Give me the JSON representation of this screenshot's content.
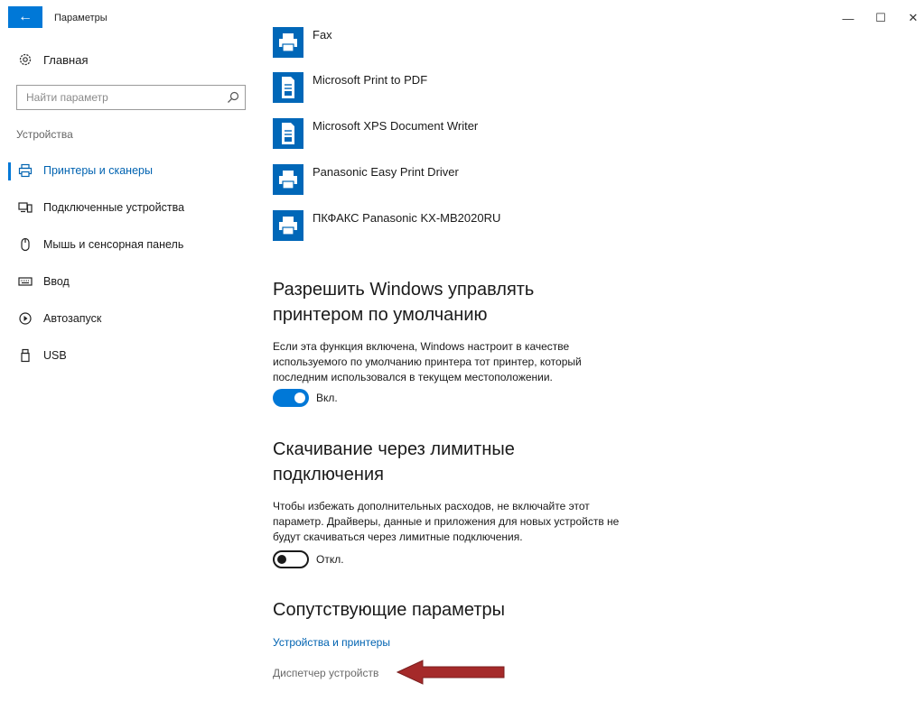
{
  "window": {
    "title": "Параметры",
    "back_glyph": "←",
    "minimize_glyph": "—",
    "maximize_glyph": "☐",
    "close_glyph": "✕"
  },
  "sidebar": {
    "home_label": "Главная",
    "search_placeholder": "Найти параметр",
    "section_label": "Устройства",
    "items": [
      {
        "label": "Принтеры и сканеры",
        "icon": "printer-icon",
        "active": true
      },
      {
        "label": "Подключенные устройства",
        "icon": "devices-icon",
        "active": false
      },
      {
        "label": "Мышь и сенсорная панель",
        "icon": "mouse-icon",
        "active": false
      },
      {
        "label": "Ввод",
        "icon": "keyboard-icon",
        "active": false
      },
      {
        "label": "Автозапуск",
        "icon": "autoplay-icon",
        "active": false
      },
      {
        "label": "USB",
        "icon": "usb-icon",
        "active": false
      }
    ]
  },
  "main": {
    "printers": [
      {
        "name": "Fax",
        "icon": "fax-printer-icon"
      },
      {
        "name": "Microsoft Print to PDF",
        "icon": "document-printer-icon"
      },
      {
        "name": "Microsoft XPS Document Writer",
        "icon": "document-printer-icon"
      },
      {
        "name": "Panasonic Easy Print Driver",
        "icon": "printer-icon"
      },
      {
        "name": "ПКФАКС Panasonic KX-MB2020RU",
        "icon": "printer-icon"
      }
    ],
    "default_printer": {
      "heading": "Разрешить Windows управлять принтером по умолчанию",
      "description": "Если эта функция включена, Windows настроит в качестве используемого по умолчанию принтера тот принтер, который последним использовался в текущем местоположении.",
      "toggle_label": "Вкл.",
      "toggle_on": true
    },
    "metered": {
      "heading": "Скачивание через лимитные подключения",
      "description": "Чтобы избежать дополнительных расходов, не включайте этот параметр. Драйверы, данные и приложения для новых устройств не будут скачиваться через лимитные подключения.",
      "toggle_label": "Откл.",
      "toggle_on": false
    },
    "related": {
      "heading": "Сопутствующие параметры",
      "links": [
        "Устройства и принтеры",
        "Диспетчер устройств"
      ]
    }
  },
  "colors": {
    "accent": "#0078d7",
    "link": "#0063b1",
    "annotation_arrow": "#a52a2a"
  }
}
